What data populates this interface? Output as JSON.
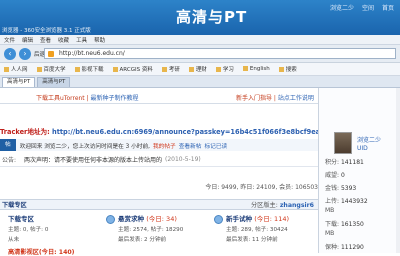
{
  "banner": {
    "title": "高清与PT",
    "top_links": [
      "浏览二少",
      "空间",
      "首页"
    ],
    "subtitle": "浏览器 - 360安全浏览器 3.1 正式版"
  },
  "menubar": [
    "文件",
    "编辑",
    "查看",
    "收藏",
    "工具",
    "帮助"
  ],
  "navbar": {
    "back_label": "后退",
    "url": "http://bt.neu6.edu.cn/"
  },
  "bookmarks": [
    "人人网",
    "百度大学",
    "影视下载",
    "ARCGIS 资料",
    "考研",
    "理财",
    "学习",
    "English",
    "搜索"
  ],
  "tabs": [
    "高清与PT",
    "高清与PT"
  ],
  "promo": {
    "left": "下载工具uTorrent",
    "left_link": "最新种子制作教程",
    "right": "新手入门指导",
    "right_link": "站点工作说明"
  },
  "tracker": {
    "label": "Tracker地址为:",
    "url": "http://bt.neu6.edu.cn:6969/announce?passkey=16b4c51f066f3e8bcf9ea2099c0cc71"
  },
  "welcome": {
    "tag": "帖",
    "text": "欢迎回来 浏览二少，您上次访问时间是在 3 小时前,",
    "link1": "我的帖子",
    "link2": "查看新帖",
    "link3": "标记已读"
  },
  "notice": {
    "label": "公告:",
    "text": "两次声明：请不要使用任何非本源的版本上传站用的",
    "date": "(2010-5-19)"
  },
  "stats": "今日: 9499, 昨日: 24109, 会员: 106503",
  "forum_head": {
    "title": "下载专区",
    "moderator_label": "分区版主:",
    "moderator": "zhangsir6"
  },
  "forums": [
    {
      "name": "下载专区",
      "today": "",
      "line1": "主题: 0, 帖子: 0",
      "line2": "从未"
    },
    {
      "name": "悬赏求种",
      "today": "(今日: 34)",
      "line1": "主题: 2574, 帖子: 18290",
      "line2": "最后发表: 2 分钟前"
    },
    {
      "name": "新手试种",
      "today": "(今日: 114)",
      "line1": "主题: 289, 帖子: 30424",
      "line2": "最后发表: 11 分钟前"
    }
  ],
  "forum_cut": "高清影视区(今日: 140)",
  "sidebar": {
    "username": "浏览二少",
    "uid_label": "UID",
    "rows": [
      {
        "label": "积分:",
        "value": "141181"
      },
      {
        "label": "威望:",
        "value": "0"
      },
      {
        "label": "金钱:",
        "value": "5393"
      },
      {
        "label": "上传:",
        "value": "1443932"
      },
      {
        "label": "MB",
        "value": ""
      },
      {
        "label": "下载:",
        "value": "161350"
      },
      {
        "label": "MB",
        "value": ""
      },
      {
        "label": "保种:",
        "value": "111290"
      }
    ]
  }
}
